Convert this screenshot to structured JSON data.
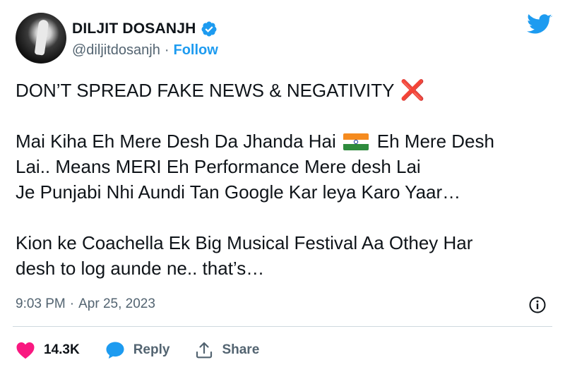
{
  "author": {
    "display_name": "DILJIT DOSANJH",
    "handle": "@diljitdosanjh",
    "separator": "·",
    "follow_label": "Follow",
    "verified": true
  },
  "tweet": {
    "line1": "DON’T SPREAD FAKE NEWS & NEGATIVITY",
    "x_mark": "❌",
    "line2a": "Mai Kiha Eh Mere Desh Da Jhanda Hai",
    "line2b": "Eh Mere Desh",
    "line3": "Lai.. Means MERI Eh Performance Mere desh Lai",
    "line4": "Je Punjabi Nhi Aundi Tan Google Kar leya Karo Yaar…",
    "line5": "Kion ke Coachella Ek Big Musical Festival Aa Othey Har",
    "line6": "desh to log aunde ne.. that’s…"
  },
  "meta": {
    "time": "9:03 PM",
    "separator": "·",
    "date": "Apr 25, 2023"
  },
  "actions": {
    "likes_count": "14.3K",
    "reply_label": "Reply",
    "share_label": "Share"
  },
  "colors": {
    "accent": "#1d9bf0",
    "like": "#f91880",
    "secondary_text": "#536471",
    "x_mark": "#d62c2c"
  },
  "icons": {
    "verified": "verified-badge-icon",
    "twitter": "twitter-bird-icon",
    "flag": "india-flag-icon",
    "info": "info-icon",
    "like": "heart-icon",
    "reply": "speech-bubble-icon",
    "share": "share-arrow-icon"
  }
}
